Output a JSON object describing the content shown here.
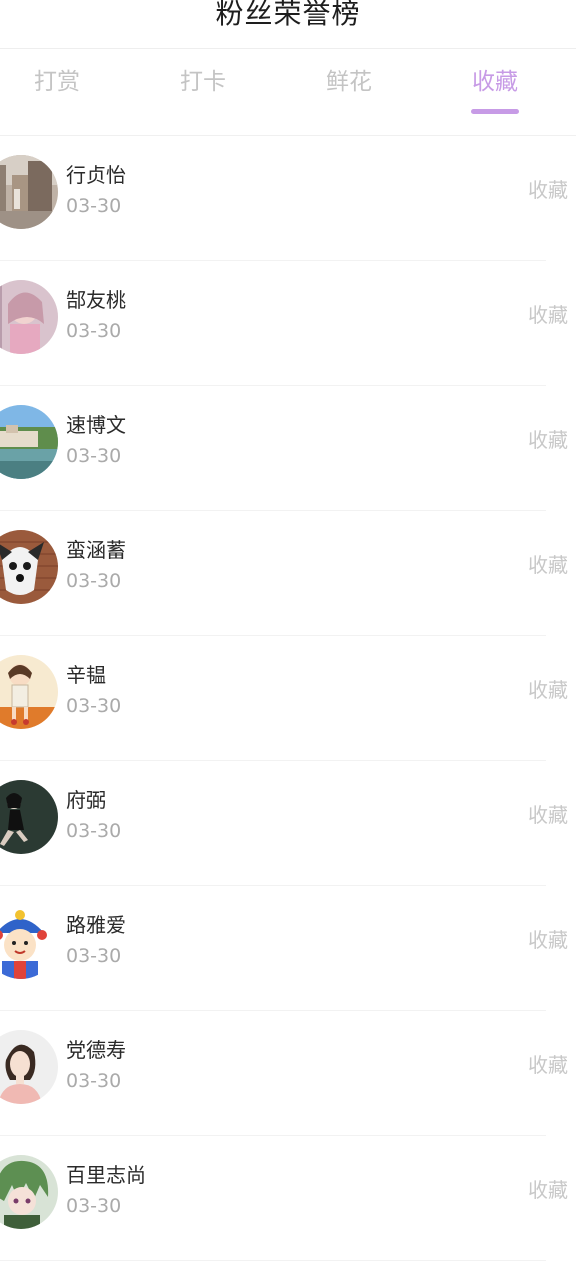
{
  "header": {
    "title": "粉丝荣誉榜"
  },
  "tabs": [
    {
      "label": "打赏",
      "active": false
    },
    {
      "label": "打卡",
      "active": false
    },
    {
      "label": "鲜花",
      "active": false
    },
    {
      "label": "收藏",
      "active": true
    }
  ],
  "colors": {
    "accent": "#c79be6",
    "inactive_tab": "#c4c4c4",
    "date_text": "#aaaaaa",
    "action_text": "#c8c8c8"
  },
  "fans": [
    {
      "name": "行贞怡",
      "date": "03-30",
      "action": "收藏",
      "avatar": "street-photo-avatar"
    },
    {
      "name": "郜友桃",
      "date": "03-30",
      "action": "收藏",
      "avatar": "pink-girl-avatar"
    },
    {
      "name": "速博文",
      "date": "03-30",
      "action": "收藏",
      "avatar": "lakeside-landscape-avatar"
    },
    {
      "name": "蛮涵蓄",
      "date": "03-30",
      "action": "收藏",
      "avatar": "husky-dog-avatar"
    },
    {
      "name": "辛韫",
      "date": "03-30",
      "action": "收藏",
      "avatar": "cartoon-girl-avatar"
    },
    {
      "name": "府弼",
      "date": "03-30",
      "action": "收藏",
      "avatar": "dark-figure-avatar"
    },
    {
      "name": "路雅爱",
      "date": "03-30",
      "action": "收藏",
      "avatar": "cartoon-boy-avatar"
    },
    {
      "name": "党德寿",
      "date": "03-30",
      "action": "收藏",
      "avatar": "woman-portrait-avatar"
    },
    {
      "name": "百里志尚",
      "date": "03-30",
      "action": "收藏",
      "avatar": "anime-green-hair-avatar"
    }
  ]
}
